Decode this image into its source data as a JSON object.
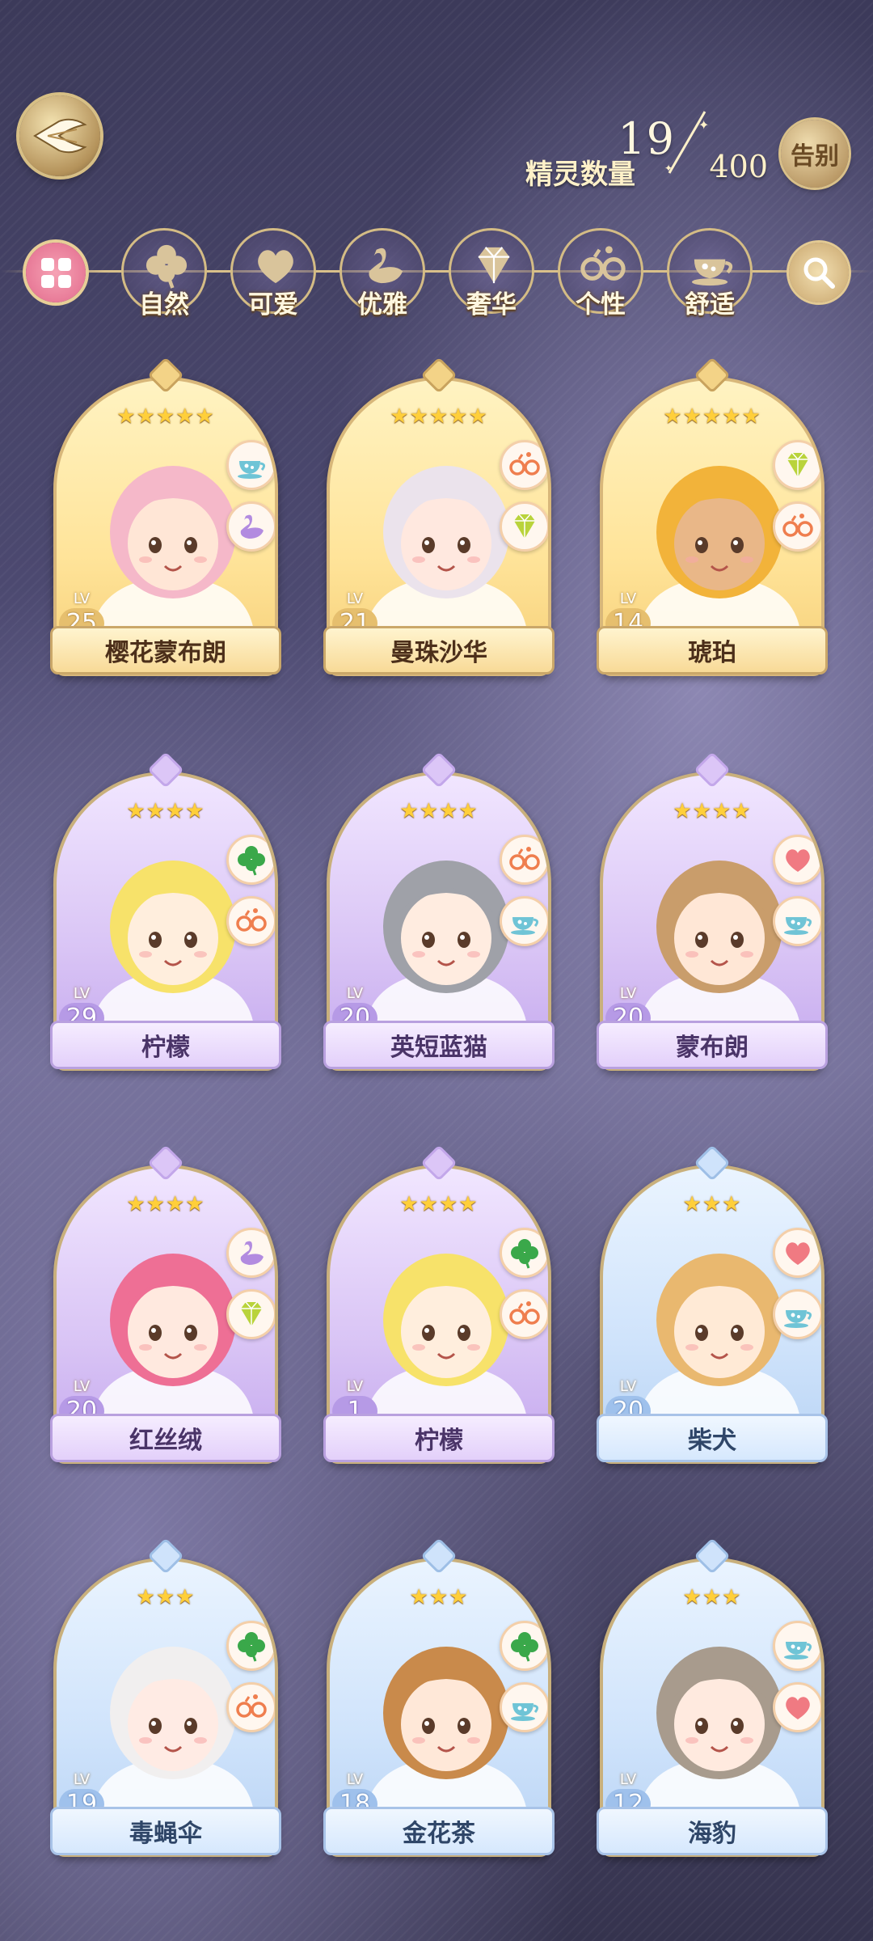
{
  "header": {
    "back_icon": "wing-back-icon",
    "count_current": "19",
    "count_label": "精灵数量",
    "count_max": "400",
    "farewell_label": "告别"
  },
  "filters": {
    "all_icon": "grid-icon",
    "items": [
      {
        "label": "自然",
        "icon": "clover-icon",
        "color": "#d9c49b"
      },
      {
        "label": "可爱",
        "icon": "heart-icon",
        "color": "#d9c49b"
      },
      {
        "label": "优雅",
        "icon": "swan-icon",
        "color": "#d9c49b"
      },
      {
        "label": "奢华",
        "icon": "diamond-icon",
        "color": "#d9c49b"
      },
      {
        "label": "个性",
        "icon": "glasses-icon",
        "color": "#d9c49b"
      },
      {
        "label": "舒适",
        "icon": "teacup-icon",
        "color": "#d9c49b"
      }
    ],
    "search_icon": "search-icon"
  },
  "cards": [
    {
      "name": "樱花蒙布朗",
      "level": "25",
      "stars": "★★★★★",
      "tier": "gold",
      "tags": [
        "teacup-icon",
        "swan-icon"
      ],
      "hair": "#f5b8c9",
      "skin": "#ffe6d6"
    },
    {
      "name": "曼珠沙华",
      "level": "21",
      "stars": "★★★★★",
      "tier": "gold",
      "tags": [
        "glasses-icon",
        "diamond-icon"
      ],
      "hair": "#ebe3ec",
      "skin": "#ffe8df"
    },
    {
      "name": "琥珀",
      "level": "14",
      "stars": "★★★★★",
      "tier": "gold",
      "tags": [
        "diamond-icon",
        "glasses-icon"
      ],
      "hair": "#f2b33a",
      "skin": "#e9b788"
    },
    {
      "name": "柠檬",
      "level": "29",
      "stars": "★★★★",
      "tier": "purple",
      "tags": [
        "clover-icon",
        "glasses-icon"
      ],
      "hair": "#f7e26a",
      "skin": "#ffeedd"
    },
    {
      "name": "英短蓝猫",
      "level": "20",
      "stars": "★★★★",
      "tier": "purple",
      "tags": [
        "glasses-icon",
        "teacup-icon"
      ],
      "hair": "#9fa1a8",
      "skin": "#ffece0"
    },
    {
      "name": "蒙布朗",
      "level": "20",
      "stars": "★★★★",
      "tier": "purple",
      "tags": [
        "heart-icon",
        "teacup-icon"
      ],
      "hair": "#c99d6b",
      "skin": "#ffe7d6"
    },
    {
      "name": "红丝绒",
      "level": "20",
      "stars": "★★★★",
      "tier": "purple",
      "tags": [
        "swan-icon",
        "diamond-icon"
      ],
      "hair": "#ee6f95",
      "skin": "#ffe9df"
    },
    {
      "name": "柠檬",
      "level": "1",
      "stars": "★★★★",
      "tier": "purple",
      "tags": [
        "clover-icon",
        "glasses-icon"
      ],
      "hair": "#f7e26a",
      "skin": "#ffeedd"
    },
    {
      "name": "柴犬",
      "level": "20",
      "stars": "★★★",
      "tier": "blue",
      "tags": [
        "heart-icon",
        "teacup-icon"
      ],
      "hair": "#e9b86f",
      "skin": "#ffead6"
    },
    {
      "name": "毒蝇伞",
      "level": "19",
      "stars": "★★★",
      "tier": "blue",
      "tags": [
        "clover-icon",
        "glasses-icon"
      ],
      "hair": "#f1efef",
      "skin": "#ffebe4"
    },
    {
      "name": "金花茶",
      "level": "18",
      "stars": "★★★",
      "tier": "blue",
      "tags": [
        "clover-icon",
        "teacup-icon"
      ],
      "hair": "#c98a4b",
      "skin": "#ffe8d8"
    },
    {
      "name": "海豹",
      "level": "12",
      "stars": "★★★",
      "tier": "blue",
      "tags": [
        "teacup-icon",
        "heart-icon"
      ],
      "hair": "#a89b8d",
      "skin": "#ffeadf"
    }
  ],
  "colors": {
    "gold_tier": "#f6cf77",
    "purple_tier": "#c4a8ee",
    "blue_tier": "#b8d3f4",
    "accent": "#d9c08a"
  }
}
